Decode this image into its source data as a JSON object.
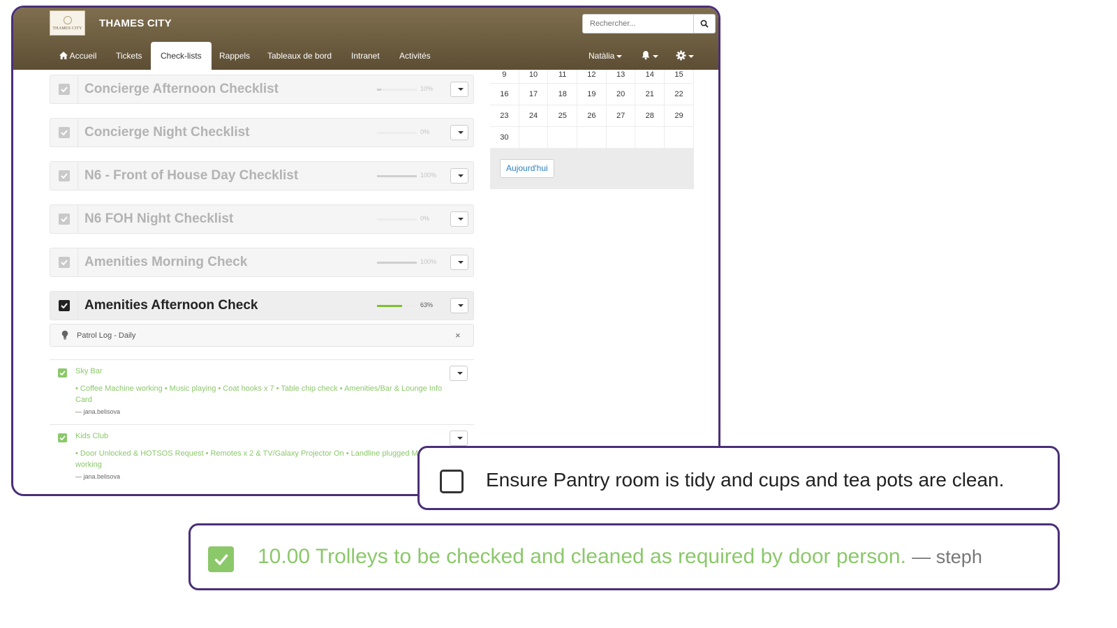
{
  "app": {
    "brand_name": "THAMES CITY",
    "logo_text": "THAMES CITY",
    "search_placeholder": "Rechercher..."
  },
  "nav": {
    "items": [
      {
        "label": "Accueil",
        "icon": "home-icon"
      },
      {
        "label": "Tickets"
      },
      {
        "label": "Check-lists",
        "active": true
      },
      {
        "label": "Rappels"
      },
      {
        "label": "Tableaux de bord"
      },
      {
        "label": "Intranet"
      },
      {
        "label": "Activités"
      }
    ],
    "user": "Natàlia",
    "bell_icon": "bell-icon",
    "settings_icon": "gear-icon"
  },
  "checklists": [
    {
      "title": "Concierge Afternoon Checklist",
      "progress": "10%",
      "progress_value": 0.1
    },
    {
      "title": "Concierge Night Checklist",
      "progress": "0%",
      "progress_value": 0.0
    },
    {
      "title": "N6 - Front of House Day Checklist",
      "progress": "100%",
      "progress_value": 1.0
    },
    {
      "title": "N6 FOH Night Checklist",
      "progress": "0%",
      "progress_value": 0.0
    },
    {
      "title": "Amenities Morning Check",
      "progress": "100%",
      "progress_value": 1.0
    },
    {
      "title": "Amenities Afternoon Check",
      "progress": "63%",
      "progress_value": 0.63,
      "active": true
    }
  ],
  "patrol": {
    "label": "Patrol Log - Daily",
    "close": "×"
  },
  "tasks": [
    {
      "title": "Sky Bar",
      "description": "• Coffee Machine working • Music playing • Coat hooks x 7 • Table chip check • Amenities/Bar & Lounge Info Card",
      "author": "— jana.belisova"
    },
    {
      "title": "Kids Club",
      "description": "• Door Unlocked & HOTSOS Request • Remotes x 2 & TV/Galaxy Projector On • Landline plugged Music working",
      "author": "— jana.belisova"
    }
  ],
  "calendar": {
    "rows": [
      [
        "9",
        "10",
        "11",
        "12",
        "13",
        "14",
        "15"
      ],
      [
        "16",
        "17",
        "18",
        "19",
        "20",
        "21",
        "22"
      ],
      [
        "23",
        "24",
        "25",
        "26",
        "27",
        "28",
        "29"
      ],
      [
        "30",
        "",
        "",
        "",
        "",
        "",
        ""
      ]
    ],
    "today_label": "Aujourd'hui"
  },
  "callouts": {
    "pantry": "Ensure Pantry room is tidy and cups and tea pots are clean.",
    "trolleys": "10.00 Trolleys to be checked and cleaned as required by door person.",
    "trolleys_by": "— steph"
  },
  "colors": {
    "navbar": "#6e5f42",
    "frame": "#4a2f78",
    "done_green": "#8bc86a",
    "progress_green": "#7dbf2e",
    "link_blue": "#2a7fc1"
  }
}
